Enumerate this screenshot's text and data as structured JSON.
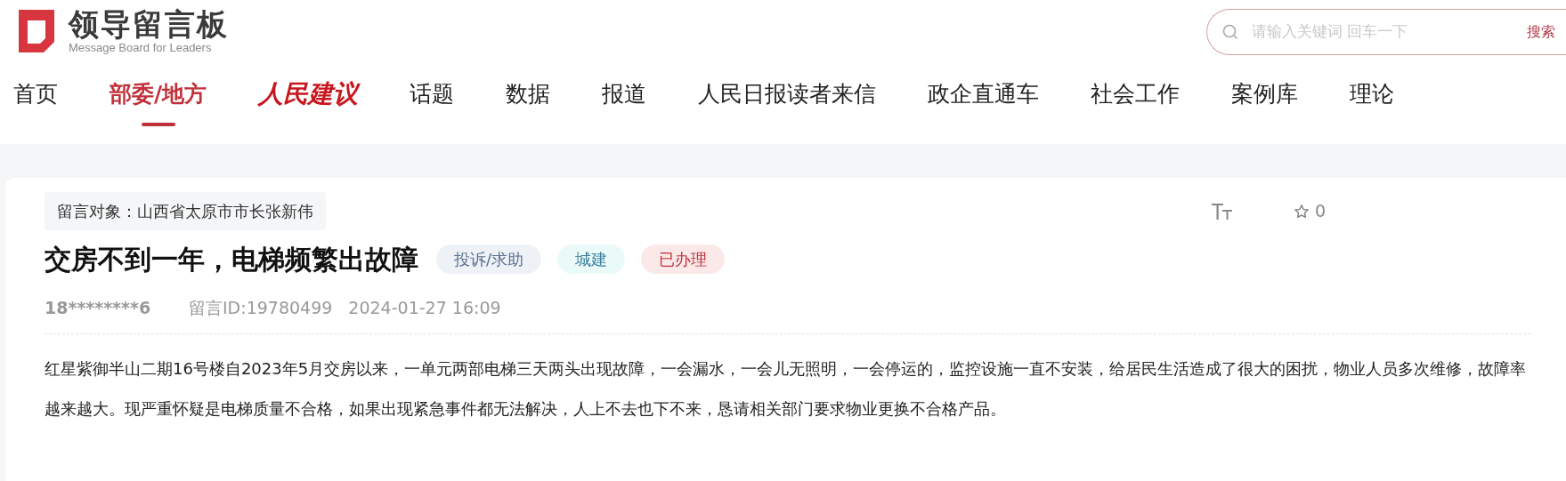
{
  "header": {
    "logo_title": "领导留言板",
    "logo_subtitle": "Message Board for Leaders",
    "search": {
      "placeholder": "请输入关键词 回车一下",
      "button": "搜索"
    }
  },
  "nav": [
    {
      "label": "首页",
      "kind": "text",
      "selected": false
    },
    {
      "label": "部委/地方",
      "kind": "text",
      "selected": true
    },
    {
      "label": "人民建议",
      "kind": "logo",
      "selected": false
    },
    {
      "label": "话题",
      "kind": "text",
      "selected": false
    },
    {
      "label": "数据",
      "kind": "text",
      "selected": false
    },
    {
      "label": "报道",
      "kind": "text",
      "selected": false
    },
    {
      "label": "人民日报读者来信",
      "kind": "text",
      "selected": false
    },
    {
      "label": "政企直通车",
      "kind": "text",
      "selected": false
    },
    {
      "label": "社会工作",
      "kind": "text",
      "selected": false
    },
    {
      "label": "案例库",
      "kind": "text",
      "selected": false
    },
    {
      "label": "理论",
      "kind": "text",
      "selected": false
    }
  ],
  "message": {
    "target": "留言对象：山西省太原市市长张新伟",
    "favorites": "0",
    "title": "交房不到一年，电梯频繁出故障",
    "tags": [
      {
        "label": "投诉/求助",
        "color": "#eef2f7"
      },
      {
        "label": "城建",
        "color": "#eafaf8"
      },
      {
        "label": "已办理",
        "color": "#fbe9ea"
      }
    ],
    "author": "18********6",
    "id": "留言ID:19780499",
    "time": "2024-01-27 16:09",
    "body": "红星紫御半山二期16号楼自2023年5月交房以来，一单元两部电梯三天两头出现故障，一会漏水，一会儿无照明，一会停运的，监控设施一直不安装，给居民生活造成了很大的困扰，物业人员多次维修，故障率越来越大。现严重怀疑是电梯质量不合格，如果出现紧急事件都无法解决，人上不去也下不来，恳请相关部门要求物业更换不合格产品。"
  }
}
